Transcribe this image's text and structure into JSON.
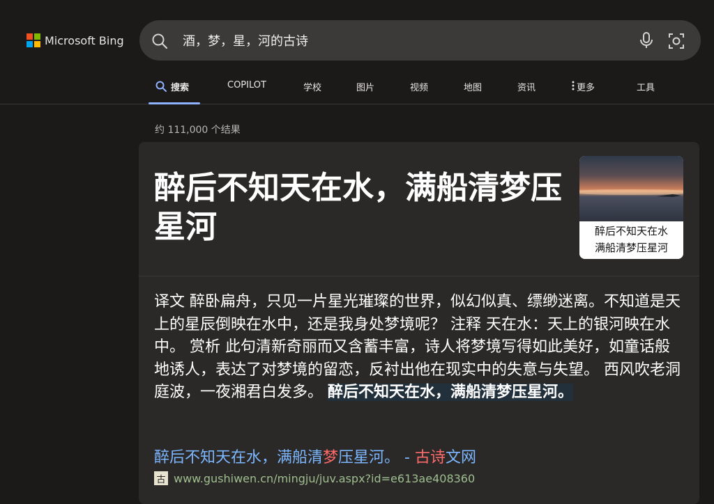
{
  "brand": {
    "name": "Microsoft Bing",
    "colors": [
      "#f25022",
      "#7fba00",
      "#00a4ef",
      "#ffb900"
    ]
  },
  "search": {
    "query": "酒，梦，星，河的古诗"
  },
  "tabs": [
    {
      "label": "搜索",
      "icon": "search-icon",
      "active": true
    },
    {
      "label": "COPILOT"
    },
    {
      "label": "学校"
    },
    {
      "label": "图片"
    },
    {
      "label": "视频"
    },
    {
      "label": "地图"
    },
    {
      "label": "资讯"
    },
    {
      "label": "更多",
      "icon": "more-vertical-icon"
    },
    {
      "label": "工具"
    }
  ],
  "results_count": "约 111,000 个结果",
  "answer": {
    "title": "醉后不知天在水，满船清梦压星河",
    "thumbnail_text": [
      "醉后不知天在水",
      "满船清梦压星河"
    ],
    "snippet": "译文 醉卧扁舟，只见一片星光璀璨的世界，似幻似真、缥缈迷离。不知道是天上的星辰倒映在水中，还是我身处梦境呢？ 注释 天在水：天上的银河映在水中。 赏析 此句清新奇丽而又含蓄丰富，诗人将梦境写得如此美好，如童话般地诱人，表达了对梦境的留恋，反衬出他在现实中的失意与失望。 西风吹老洞庭波，一夜湘君白发多。",
    "snippet_bold": "醉后不知天在水，满船清梦压星河。",
    "link": {
      "part1": "醉后不知天在水，满船清",
      "hl1": "梦",
      "part2": "压星河。 - ",
      "hl2": "古诗",
      "part3": "文网"
    },
    "favicon_char": "古",
    "url": "www.gushiwen.cn/mingju/juv.aspx?id=e613ae408360"
  }
}
